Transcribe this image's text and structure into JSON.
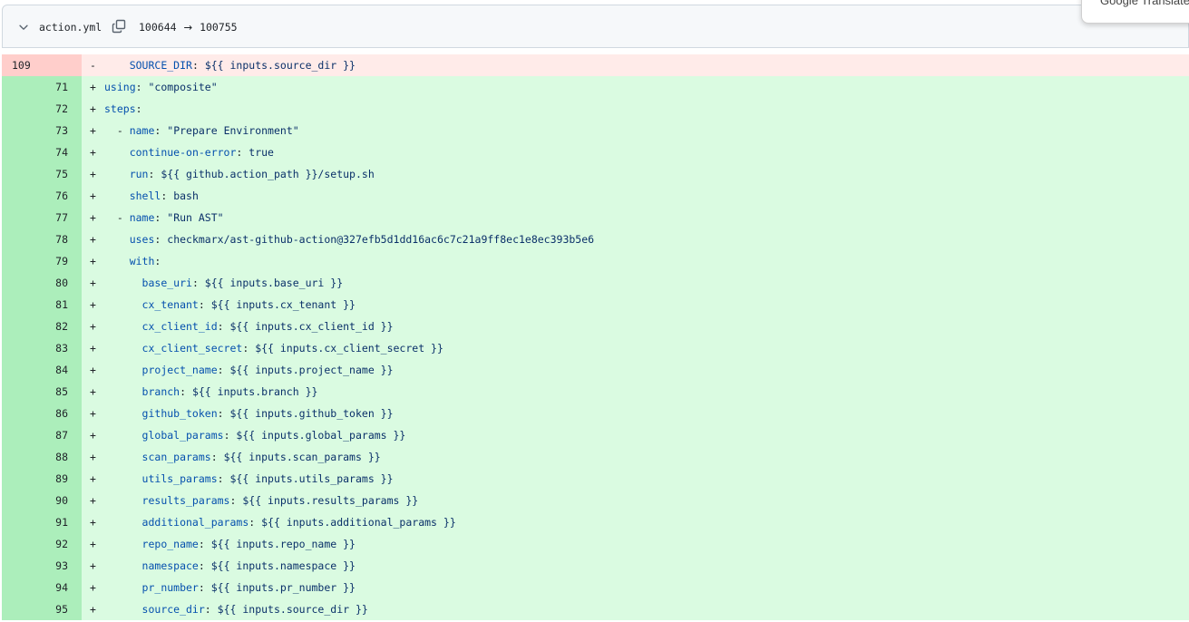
{
  "file_header": {
    "filename": "action.yml",
    "mode_from": "100644",
    "mode_arrow": "→",
    "mode_to": "100755"
  },
  "overlay": {
    "google_translate_label": "Google Translate"
  },
  "diff_lines": [
    {
      "type": "del",
      "num": "109",
      "sign": "-",
      "indent": "    ",
      "key": "SOURCE_DIR",
      "sep": ": ",
      "val": "${{ inputs.source_dir }}"
    },
    {
      "type": "add",
      "num": "71",
      "sign": "+",
      "indent": "",
      "key": "using",
      "sep": ": ",
      "val": "\"composite\""
    },
    {
      "type": "add",
      "num": "72",
      "sign": "+",
      "indent": "",
      "key": "steps",
      "sep": ":",
      "val": ""
    },
    {
      "type": "add",
      "num": "73",
      "sign": "+",
      "indent": "  - ",
      "key": "name",
      "sep": ": ",
      "val": "\"Prepare Environment\""
    },
    {
      "type": "add",
      "num": "74",
      "sign": "+",
      "indent": "    ",
      "key": "continue-on-error",
      "sep": ": ",
      "val": "true"
    },
    {
      "type": "add",
      "num": "75",
      "sign": "+",
      "indent": "    ",
      "key": "run",
      "sep": ": ",
      "val": "${{ github.action_path }}/setup.sh"
    },
    {
      "type": "add",
      "num": "76",
      "sign": "+",
      "indent": "    ",
      "key": "shell",
      "sep": ": ",
      "val": "bash"
    },
    {
      "type": "add",
      "num": "77",
      "sign": "+",
      "indent": "  - ",
      "key": "name",
      "sep": ": ",
      "val": "\"Run AST\""
    },
    {
      "type": "add",
      "num": "78",
      "sign": "+",
      "indent": "    ",
      "key": "uses",
      "sep": ": ",
      "val": "checkmarx/ast-github-action@327efb5d1dd16ac6c7c21a9ff8ec1e8ec393b5e6"
    },
    {
      "type": "add",
      "num": "79",
      "sign": "+",
      "indent": "    ",
      "key": "with",
      "sep": ":",
      "val": ""
    },
    {
      "type": "add",
      "num": "80",
      "sign": "+",
      "indent": "      ",
      "key": "base_uri",
      "sep": ": ",
      "val": "${{ inputs.base_uri }}"
    },
    {
      "type": "add",
      "num": "81",
      "sign": "+",
      "indent": "      ",
      "key": "cx_tenant",
      "sep": ": ",
      "val": "${{ inputs.cx_tenant }}"
    },
    {
      "type": "add",
      "num": "82",
      "sign": "+",
      "indent": "      ",
      "key": "cx_client_id",
      "sep": ": ",
      "val": "${{ inputs.cx_client_id }}"
    },
    {
      "type": "add",
      "num": "83",
      "sign": "+",
      "indent": "      ",
      "key": "cx_client_secret",
      "sep": ": ",
      "val": "${{ inputs.cx_client_secret }}"
    },
    {
      "type": "add",
      "num": "84",
      "sign": "+",
      "indent": "      ",
      "key": "project_name",
      "sep": ": ",
      "val": "${{ inputs.project_name }}"
    },
    {
      "type": "add",
      "num": "85",
      "sign": "+",
      "indent": "      ",
      "key": "branch",
      "sep": ": ",
      "val": "${{ inputs.branch }}"
    },
    {
      "type": "add",
      "num": "86",
      "sign": "+",
      "indent": "      ",
      "key": "github_token",
      "sep": ": ",
      "val": "${{ inputs.github_token }}"
    },
    {
      "type": "add",
      "num": "87",
      "sign": "+",
      "indent": "      ",
      "key": "global_params",
      "sep": ": ",
      "val": "${{ inputs.global_params }}"
    },
    {
      "type": "add",
      "num": "88",
      "sign": "+",
      "indent": "      ",
      "key": "scan_params",
      "sep": ": ",
      "val": "${{ inputs.scan_params }}"
    },
    {
      "type": "add",
      "num": "89",
      "sign": "+",
      "indent": "      ",
      "key": "utils_params",
      "sep": ": ",
      "val": "${{ inputs.utils_params }}"
    },
    {
      "type": "add",
      "num": "90",
      "sign": "+",
      "indent": "      ",
      "key": "results_params",
      "sep": ": ",
      "val": "${{ inputs.results_params }}"
    },
    {
      "type": "add",
      "num": "91",
      "sign": "+",
      "indent": "      ",
      "key": "additional_params",
      "sep": ": ",
      "val": "${{ inputs.additional_params }}"
    },
    {
      "type": "add",
      "num": "92",
      "sign": "+",
      "indent": "      ",
      "key": "repo_name",
      "sep": ": ",
      "val": "${{ inputs.repo_name }}"
    },
    {
      "type": "add",
      "num": "93",
      "sign": "+",
      "indent": "      ",
      "key": "namespace",
      "sep": ": ",
      "val": "${{ inputs.namespace }}"
    },
    {
      "type": "add",
      "num": "94",
      "sign": "+",
      "indent": "      ",
      "key": "pr_number",
      "sep": ": ",
      "val": "${{ inputs.pr_number }}"
    },
    {
      "type": "add",
      "num": "95",
      "sign": "+",
      "indent": "      ",
      "key": "source_dir",
      "sep": ": ",
      "val": "${{ inputs.source_dir }}"
    }
  ]
}
